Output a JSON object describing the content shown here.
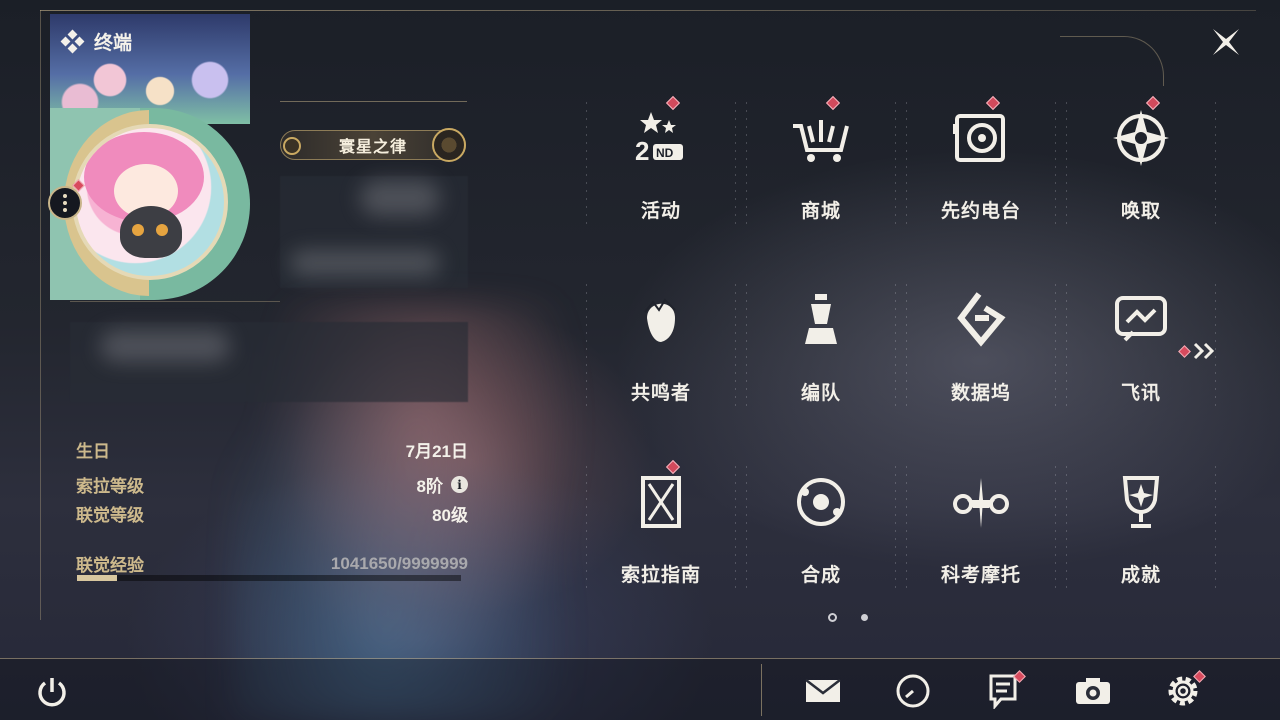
{
  "header": {
    "title": "终端",
    "title_icon": "diamond-cluster-icon",
    "close_icon": "close-icon"
  },
  "profile": {
    "more_icon": "more-vertical-icon",
    "title_badge": "寰星之律"
  },
  "stats": [
    {
      "label": "生日",
      "value": "7月21日"
    },
    {
      "label": "索拉等级",
      "value": "8阶",
      "info": "i"
    },
    {
      "label": "联觉等级",
      "value": "80级"
    },
    {
      "label": "联觉经验",
      "value": "1041650/9999999"
    }
  ],
  "experience": {
    "current": 1041650,
    "max": 9999999,
    "fraction": 0.104
  },
  "menu": {
    "items": [
      {
        "label": "活动",
        "icon": "event-2nd-icon",
        "badge": true
      },
      {
        "label": "商城",
        "icon": "shop-cart-icon",
        "badge": true
      },
      {
        "label": "先约电台",
        "icon": "radio-station-icon",
        "badge": true
      },
      {
        "label": "唤取",
        "icon": "convene-compass-icon",
        "badge": true
      },
      {
        "label": "共鸣者",
        "icon": "resonator-portrait-icon",
        "badge": false
      },
      {
        "label": "编队",
        "icon": "chess-team-icon",
        "badge": false
      },
      {
        "label": "数据坞",
        "icon": "data-bank-icon",
        "badge": false
      },
      {
        "label": "飞讯",
        "icon": "chat-message-icon",
        "badge": false
      },
      {
        "label": "索拉指南",
        "icon": "guide-book-icon",
        "badge": true
      },
      {
        "label": "合成",
        "icon": "synthesis-orbit-icon",
        "badge": false
      },
      {
        "label": "科考摩托",
        "icon": "motorcycle-icon",
        "badge": false
      },
      {
        "label": "成就",
        "icon": "trophy-icon",
        "badge": false
      }
    ],
    "next_icon": "double-chevron-right-icon",
    "pages": 2,
    "current_page": 1
  },
  "bottom_bar": {
    "power_icon": "power-icon",
    "buttons": [
      {
        "name": "mail",
        "icon": "mail-icon",
        "badge": false
      },
      {
        "name": "history",
        "icon": "clock-icon",
        "badge": false
      },
      {
        "name": "notes",
        "icon": "notice-board-icon",
        "badge": true
      },
      {
        "name": "photo",
        "icon": "camera-icon",
        "badge": false
      },
      {
        "name": "settings",
        "icon": "gear-icon",
        "badge": true
      }
    ]
  },
  "colors": {
    "accent_gold": "#cdb98c",
    "badge_red": "#d14a5c",
    "text_light": "#f2efe8"
  }
}
